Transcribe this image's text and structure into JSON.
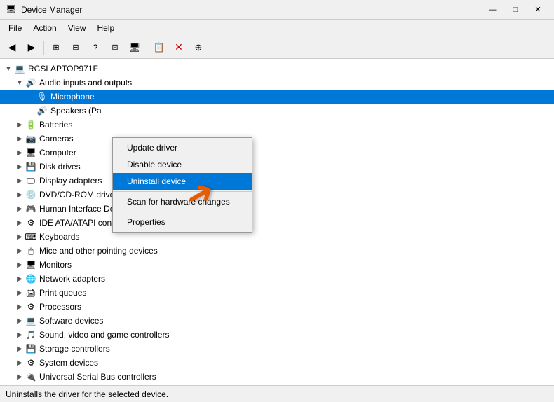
{
  "titleBar": {
    "icon": "🖥",
    "title": "Device Manager",
    "minimize": "—",
    "maximize": "□",
    "close": "✕"
  },
  "menuBar": {
    "items": [
      "File",
      "Action",
      "View",
      "Help"
    ]
  },
  "toolbar": {
    "buttons": [
      "◀",
      "▶",
      "⊞",
      "⊟",
      "?",
      "⊡",
      "🖥",
      "📋",
      "✕",
      "⊕"
    ]
  },
  "tree": {
    "root": "RCSLAPTOP971F",
    "items": [
      {
        "id": "audio",
        "label": "Audio inputs and outputs",
        "indent": 1,
        "expanded": true,
        "icon": "🔊"
      },
      {
        "id": "microphone",
        "label": "Microphone",
        "indent": 2,
        "selected": true,
        "icon": "🎙"
      },
      {
        "id": "speakers",
        "label": "Speakers (Pa",
        "indent": 2,
        "icon": "🔊"
      },
      {
        "id": "batteries",
        "label": "Batteries",
        "indent": 1,
        "icon": "🔋"
      },
      {
        "id": "cameras",
        "label": "Cameras",
        "indent": 1,
        "icon": "📷"
      },
      {
        "id": "computer",
        "label": "Computer",
        "indent": 1,
        "icon": "🖥"
      },
      {
        "id": "disk",
        "label": "Disk drives",
        "indent": 1,
        "icon": "💾"
      },
      {
        "id": "display",
        "label": "Display adapters",
        "indent": 1,
        "icon": "🖵"
      },
      {
        "id": "dvd",
        "label": "DVD/CD-ROM drives",
        "indent": 1,
        "icon": "💿"
      },
      {
        "id": "hid",
        "label": "Human Interface Devices",
        "indent": 1,
        "icon": "🎮"
      },
      {
        "id": "ide",
        "label": "IDE ATA/ATAPI controllers",
        "indent": 1,
        "icon": "⚙"
      },
      {
        "id": "keyboards",
        "label": "Keyboards",
        "indent": 1,
        "icon": "⌨"
      },
      {
        "id": "mice",
        "label": "Mice and other pointing devices",
        "indent": 1,
        "icon": "🖱"
      },
      {
        "id": "monitors",
        "label": "Monitors",
        "indent": 1,
        "icon": "🖥"
      },
      {
        "id": "network",
        "label": "Network adapters",
        "indent": 1,
        "icon": "🌐"
      },
      {
        "id": "print",
        "label": "Print queues",
        "indent": 1,
        "icon": "🖨"
      },
      {
        "id": "processors",
        "label": "Processors",
        "indent": 1,
        "icon": "⚙"
      },
      {
        "id": "software",
        "label": "Software devices",
        "indent": 1,
        "icon": "💻"
      },
      {
        "id": "sound",
        "label": "Sound, video and game controllers",
        "indent": 1,
        "icon": "🎵"
      },
      {
        "id": "storage",
        "label": "Storage controllers",
        "indent": 1,
        "icon": "💾"
      },
      {
        "id": "system",
        "label": "System devices",
        "indent": 1,
        "icon": "⚙"
      },
      {
        "id": "usb",
        "label": "Universal Serial Bus controllers",
        "indent": 1,
        "icon": "🔌"
      }
    ]
  },
  "contextMenu": {
    "items": [
      {
        "id": "update",
        "label": "Update driver",
        "highlighted": false
      },
      {
        "id": "disable",
        "label": "Disable device",
        "highlighted": false
      },
      {
        "id": "uninstall",
        "label": "Uninstall device",
        "highlighted": true
      },
      {
        "id": "sep1",
        "type": "sep"
      },
      {
        "id": "scan",
        "label": "Scan for hardware changes",
        "highlighted": false
      },
      {
        "id": "sep2",
        "type": "sep"
      },
      {
        "id": "properties",
        "label": "Properties",
        "highlighted": false
      }
    ]
  },
  "statusBar": {
    "text": "Uninstalls the driver for the selected device."
  }
}
